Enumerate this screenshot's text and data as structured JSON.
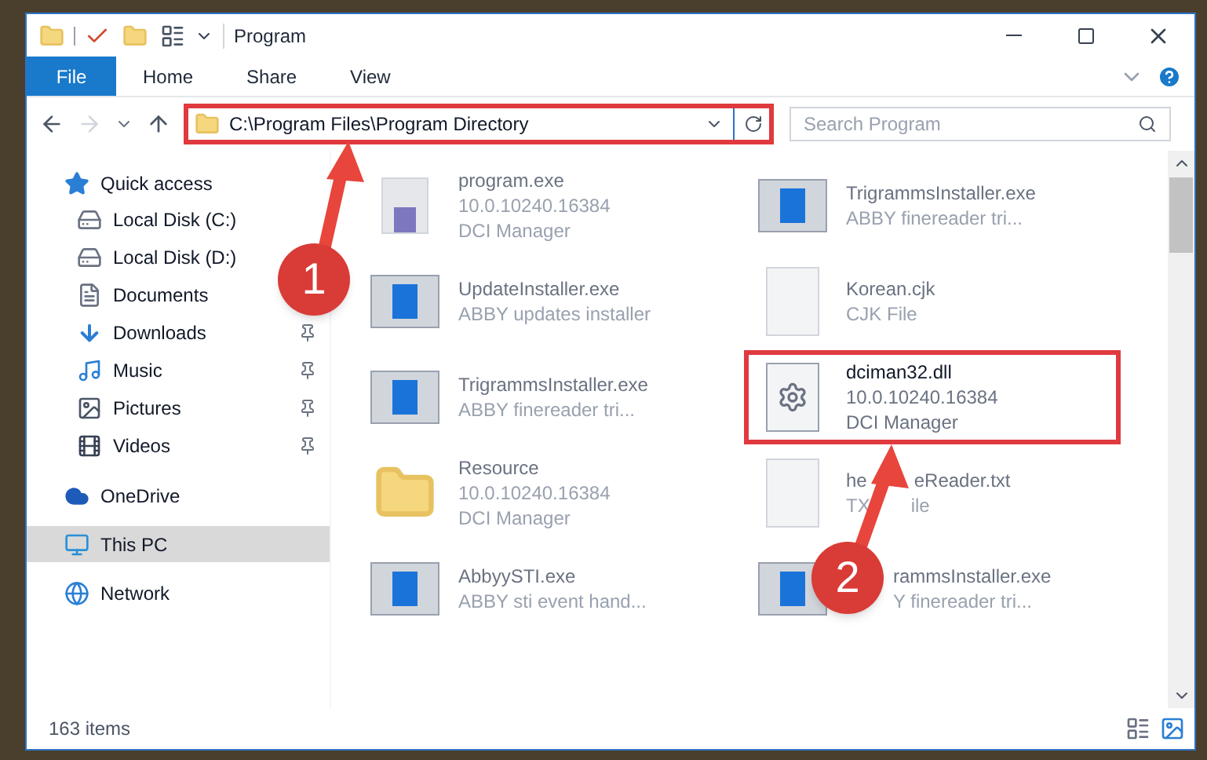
{
  "window": {
    "title": "Program"
  },
  "ribbon_tabs": [
    {
      "label": "File",
      "selected": true
    },
    {
      "label": "Home",
      "selected": false
    },
    {
      "label": "Share",
      "selected": false
    },
    {
      "label": "View",
      "selected": false
    }
  ],
  "address": {
    "path": "C:\\Program Files\\Program Directory",
    "highlighted": true
  },
  "search": {
    "placeholder": "Search Program"
  },
  "sidebar": {
    "items": [
      {
        "label": "Quick access",
        "kind": "star",
        "selected": false,
        "children": [
          {
            "label": "Local Disk (C:)",
            "kind": "drive-c",
            "pinned": false
          },
          {
            "label": "Local Disk (D:)",
            "kind": "drive"
          },
          {
            "label": "Documents",
            "kind": "documents"
          },
          {
            "label": "Downloads",
            "kind": "downloads",
            "pinned": true
          },
          {
            "label": "Music",
            "kind": "music",
            "pinned": true
          },
          {
            "label": "Pictures",
            "kind": "pictures",
            "pinned": true
          },
          {
            "label": "Videos",
            "kind": "videos",
            "pinned": true
          }
        ]
      },
      {
        "label": "OneDrive",
        "kind": "cloud",
        "selected": false
      },
      {
        "label": "This PC",
        "kind": "pc",
        "selected": true
      },
      {
        "label": "Network",
        "kind": "network",
        "selected": false
      }
    ]
  },
  "files": [
    {
      "name": [
        "program.exe"
      ],
      "details": [
        [
          "10.0.10240.16384"
        ],
        [
          "DCI Manager"
        ]
      ],
      "kind": "app",
      "dimmed": true,
      "highlighted": false,
      "obscured": false
    },
    {
      "name": [
        "TrigrammsInstaller.exe"
      ],
      "details": [
        [
          "ABBY finereader tri..."
        ]
      ],
      "kind": "installer",
      "dimmed": true,
      "highlighted": false,
      "obscured": false
    },
    {
      "name": [
        "UpdateInstaller.exe"
      ],
      "details": [
        [
          "ABBY updates installer"
        ]
      ],
      "kind": "installer",
      "dimmed": true,
      "highlighted": false,
      "obscured": false
    },
    {
      "name": [
        "Korean.cjk"
      ],
      "details": [
        [
          "CJK File"
        ]
      ],
      "kind": "page",
      "dimmed": true,
      "highlighted": false,
      "obscured": false
    },
    {
      "name": [
        "TrigrammsInstaller.exe"
      ],
      "details": [
        [
          "ABBY finereader tri..."
        ]
      ],
      "kind": "installer",
      "dimmed": true,
      "highlighted": false,
      "obscured": false
    },
    {
      "name": [
        "dciman32.dll"
      ],
      "details": [
        [
          "10.0.10240.16384"
        ],
        [
          "DCI Manager"
        ]
      ],
      "kind": "dll",
      "dimmed": false,
      "highlighted": true,
      "obscured": false
    },
    {
      "name": [
        "Resource"
      ],
      "details": [
        [
          "10.0.10240.16384"
        ],
        [
          "DCI Manager"
        ]
      ],
      "kind": "folder",
      "dimmed": true,
      "highlighted": false,
      "obscured": false
    },
    {
      "name": [
        "he",
        "eReader.txt"
      ],
      "details": [
        [
          "TX",
          "ile"
        ]
      ],
      "kind": "page",
      "dimmed": true,
      "highlighted": false,
      "obscured": false
    },
    {
      "name": [
        "AbbyySTI.exe"
      ],
      "details": [
        [
          "ABBY sti event hand..."
        ]
      ],
      "kind": "installer",
      "dimmed": true,
      "highlighted": false,
      "obscured": false
    },
    {
      "name": [
        "rammsInstaller.exe"
      ],
      "details": [
        [
          "Y finereader tri..."
        ]
      ],
      "kind": "installer",
      "dimmed": true,
      "highlighted": false,
      "obscured": true
    }
  ],
  "status_bar": {
    "count": "163 items"
  },
  "callouts": [
    {
      "number": "1"
    },
    {
      "number": "2"
    }
  ]
}
